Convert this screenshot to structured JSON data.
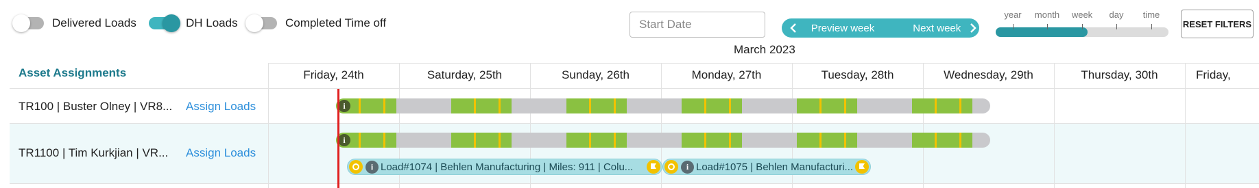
{
  "toggles": [
    {
      "label": "Delivered Loads",
      "state": "off"
    },
    {
      "label": "DH Loads",
      "state": "on"
    },
    {
      "label": "Completed Time off",
      "state": "off"
    }
  ],
  "start_date": {
    "value": "",
    "placeholder": "Start Date"
  },
  "week_nav": {
    "prev": "Preview week",
    "next": "Next week"
  },
  "zoom": {
    "options": [
      "year",
      "month",
      "week",
      "day",
      "time"
    ],
    "selected": "week"
  },
  "reset_label": "RESET FILTERS",
  "calendar": {
    "month": "March 2023",
    "side_header": "Asset Assignments",
    "days": [
      "Friday, 24th",
      "Saturday, 25th",
      "Sunday, 26th",
      "Monday, 27th",
      "Tuesday, 28th",
      "Wednesday, 29th",
      "Thursday, 30th",
      "Friday,"
    ]
  },
  "rows": [
    {
      "name": "TR100 | Buster Olney | VR8...",
      "action": "Assign Loads",
      "loads": []
    },
    {
      "name": "TR1100 | Tim Kurkjian | VR...",
      "action": "Assign Loads",
      "loads": [
        {
          "text": "Load#1074 | Behlen Manufacturing | Miles: 911 |  Colu..."
        },
        {
          "text": "Load#1075 | Behlen Manufacturi..."
        }
      ]
    }
  ],
  "colors": {
    "accent": "#3fb5bf",
    "accent_dark": "#2a97a2",
    "bar_green": "#8ac141",
    "bar_gray": "#c9c9cc",
    "marker_yellow": "#f2c200",
    "now_red": "#e02020",
    "link_blue": "#2d8fdb",
    "title_teal": "#1d7a8c"
  },
  "icons": {
    "prev": "chevron-left-icon",
    "next": "chevron-right-icon",
    "info": "info-icon",
    "start": "start-circle-icon",
    "finish": "flag-icon"
  }
}
